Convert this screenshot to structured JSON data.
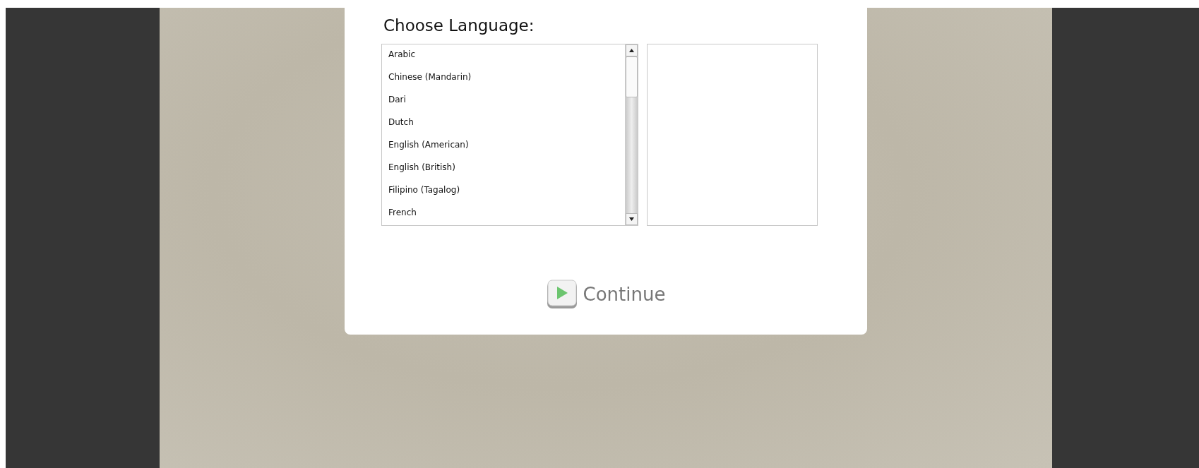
{
  "heading": "Choose Language:",
  "languages": [
    {
      "label": "Arabic",
      "selected": false
    },
    {
      "label": "Chinese (Mandarin)",
      "selected": false
    },
    {
      "label": "Dari",
      "selected": false
    },
    {
      "label": "Dutch",
      "selected": false
    },
    {
      "label": "English (American)",
      "selected": false
    },
    {
      "label": "English (British)",
      "selected": false
    },
    {
      "label": "Filipino (Tagalog)",
      "selected": false
    },
    {
      "label": "French",
      "selected": false
    }
  ],
  "continue_button": {
    "label": "Continue"
  }
}
